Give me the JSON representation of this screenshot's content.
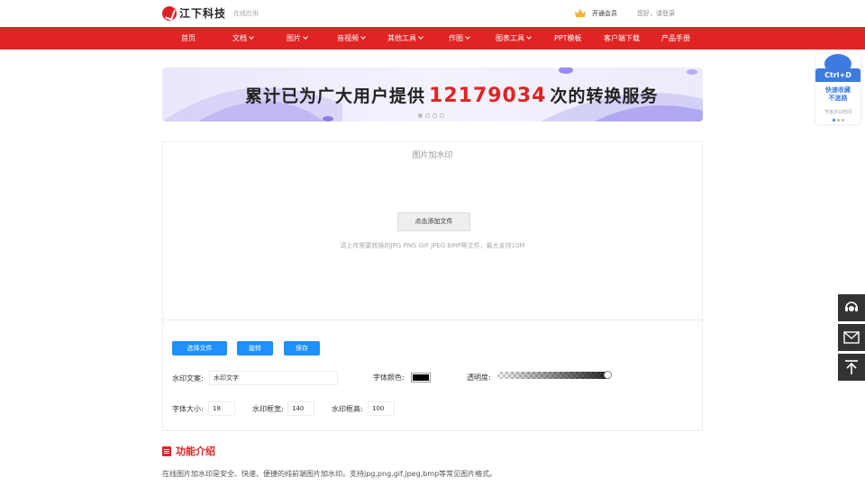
{
  "header": {
    "brand": "江下科技",
    "sub": "在线应用",
    "vip_label": "开通会员",
    "login_label": "您好，请登录"
  },
  "nav": {
    "items": [
      {
        "label": "首页",
        "dropdown": false
      },
      {
        "label": "文档",
        "dropdown": true
      },
      {
        "label": "图片",
        "dropdown": true
      },
      {
        "label": "音视频",
        "dropdown": true
      },
      {
        "label": "其他工具",
        "dropdown": true
      },
      {
        "label": "作图",
        "dropdown": true
      },
      {
        "label": "图表工具",
        "dropdown": true
      },
      {
        "label": "PPT模板",
        "dropdown": false
      },
      {
        "label": "客户端下载",
        "dropdown": false
      },
      {
        "label": "产品手册",
        "dropdown": false
      }
    ]
  },
  "banner": {
    "prefix": "累计已为广大用户提供",
    "count": "12179034",
    "suffix": "次的转换服务",
    "slide_count": 4,
    "active_slide": 1
  },
  "tool": {
    "title": "图片加水印",
    "add_file_label": "点击添加文件",
    "hint": "请上传需要转换的JPG PNG GIF JPEG BMP等文件，最大支持10M",
    "select_label": "选择文件",
    "rotate_label": "旋转",
    "save_label": "保存",
    "watermark_text_label": "水印文案:",
    "watermark_text_value": "水印文字",
    "font_color_label": "字体颜色:",
    "font_color_value": "#000000",
    "opacity_label": "透明度:",
    "opacity_value": 1.0,
    "font_size_label": "字体大小:",
    "font_size_value": "18",
    "box_width_label": "水印框宽:",
    "box_width_value": "140",
    "box_height_label": "水印框高:",
    "box_height_value": "100"
  },
  "intro": {
    "title": "功能介绍",
    "text": "在线图片加水印是安全、快速、便捷的纯前端图片加水印。支持jpg,png,gif,jpeg,bmp等常见图片格式。"
  },
  "side_card": {
    "shortcut": "Ctrl+D",
    "line1": "快速收藏",
    "line2": "不迷路",
    "tip": "节省办公时间"
  },
  "side_buttons": [
    "customer-service-icon",
    "mail-icon",
    "back-to-top-icon"
  ],
  "colors": {
    "brand_red": "#e02424",
    "action_blue": "#1e90ff",
    "side_dark": "#333333"
  }
}
